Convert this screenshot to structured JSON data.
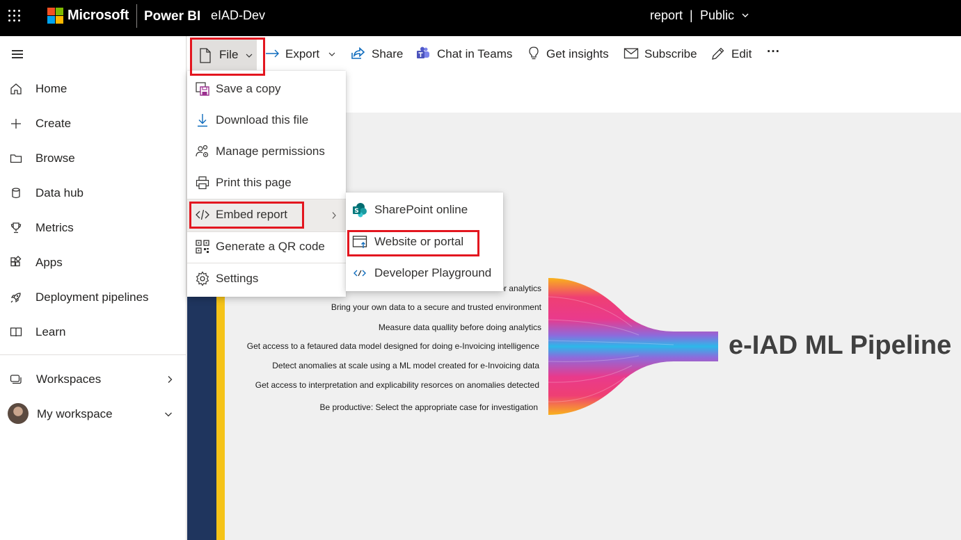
{
  "header": {
    "company": "Microsoft",
    "product": "Power BI",
    "workspace": "eIAD-Dev",
    "item_type": "report",
    "separator": "|",
    "sensitivity": "Public"
  },
  "leftnav": {
    "items": [
      {
        "label": "Home",
        "icon": "home-icon"
      },
      {
        "label": "Create",
        "icon": "plus-icon"
      },
      {
        "label": "Browse",
        "icon": "folder-icon"
      },
      {
        "label": "Data hub",
        "icon": "database-icon"
      },
      {
        "label": "Metrics",
        "icon": "trophy-icon"
      },
      {
        "label": "Apps",
        "icon": "apps-icon"
      },
      {
        "label": "Deployment pipelines",
        "icon": "rocket-icon"
      },
      {
        "label": "Learn",
        "icon": "book-icon"
      }
    ],
    "workspaces": "Workspaces",
    "my_workspace": "My workspace"
  },
  "commandbar": {
    "file": "File",
    "export": "Export",
    "share": "Share",
    "chat": "Chat in Teams",
    "insights": "Get insights",
    "subscribe": "Subscribe",
    "edit": "Edit",
    "more": "···"
  },
  "file_menu": {
    "items": [
      {
        "label": "Save a copy",
        "icon": "save-copy-icon"
      },
      {
        "label": "Download this file",
        "icon": "download-icon"
      },
      {
        "label": "Manage permissions",
        "icon": "permissions-icon"
      },
      {
        "label": "Print this page",
        "icon": "printer-icon"
      },
      {
        "label": "Embed report",
        "icon": "code-icon"
      },
      {
        "label": "Generate a QR code",
        "icon": "qr-code-icon"
      },
      {
        "label": "Settings",
        "icon": "gear-icon"
      }
    ]
  },
  "embed_menu": {
    "items": [
      {
        "label": "SharePoint online",
        "icon": "sharepoint-icon"
      },
      {
        "label": "Website or portal",
        "icon": "website-icon"
      },
      {
        "label": "Developer Playground",
        "icon": "developer-icon"
      }
    ]
  },
  "report": {
    "title": "e-IAD ML Pipeline",
    "lines": [
      "or analytics",
      "Bring your own data to a secure and trusted environment",
      "Measure data quallity before doing analytics",
      "Get access to a fetaured data model designed for doing e-Invoicing intelligence",
      "Detect anomalies at scale using a ML model created for e-Invoicing data",
      "Get access to interpretation and explicability resorces on anomalies detected",
      "Be productive: Select the appropriate case for investigation"
    ]
  },
  "colors": {
    "highlight_border": "#e3161f",
    "report_navy": "#1f355e",
    "report_gold": "#f5c318"
  }
}
